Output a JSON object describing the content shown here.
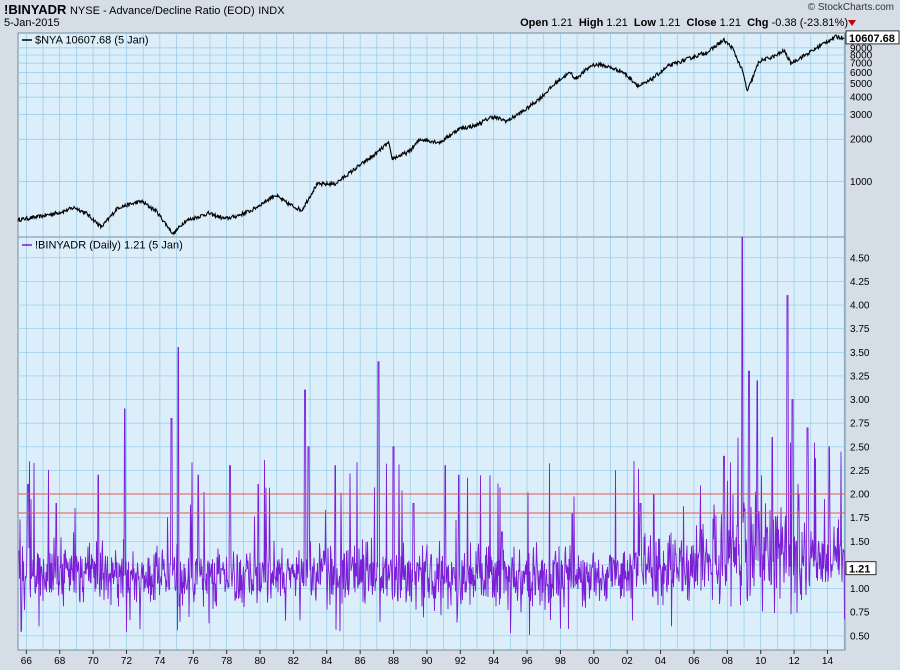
{
  "header": {
    "symbol": "!BINYADR",
    "description": "NYSE - Advance/Decline Ratio (EOD)",
    "exchange": "INDX",
    "date": "5-Jan-2015",
    "logo": "© StockCharts.com",
    "open_label": "Open",
    "open": "1.21",
    "high_label": "High",
    "high": "1.21",
    "low_label": "Low",
    "low": "1.21",
    "close_label": "Close",
    "close": "1.21",
    "chg_label": "Chg",
    "chg": "-0.38 (-23.81%)"
  },
  "colors": {
    "background": "#d5dde6",
    "plot_bg": "#dceefa",
    "grid": "#8fcbe8",
    "price_line": "#000000",
    "ratio_line": "#7a1fd6",
    "ref_line": "#e05555"
  },
  "chart_data": [
    {
      "type": "line",
      "legend": "$NYA 10607.68 (5 Jan)",
      "last_value_label": "10607.68",
      "yscale": "log",
      "y_ticks": [
        1000,
        2000,
        3000,
        4000,
        5000,
        6000,
        7000,
        8000,
        9000
      ],
      "ylim": [
        400,
        11500
      ],
      "x": [
        1965.5,
        1966.8,
        1968,
        1968.9,
        1969.6,
        1970.5,
        1971.5,
        1972.9,
        1973.8,
        1974.8,
        1975.5,
        1976.9,
        1977.9,
        1978.5,
        1979.5,
        1980.9,
        1981.6,
        1982.5,
        1983.4,
        1984.5,
        1985.9,
        1986.9,
        1987.7,
        1987.9,
        1988.9,
        1989.6,
        1990.8,
        1991.9,
        1992.9,
        1993.9,
        1994.8,
        1995.9,
        1996.9,
        1997.9,
        1998.6,
        1998.9,
        1999.9,
        2000.5,
        2001.7,
        2002.7,
        2003.2,
        2004.5,
        2005.9,
        2006.9,
        2007.4,
        2007.8,
        2008.3,
        2008.9,
        2009.2,
        2009.9,
        2010.9,
        2011.4,
        2011.8,
        2012.9,
        2013.9,
        2014.5,
        2015.0
      ],
      "values": [
        530,
        560,
        600,
        650,
        590,
        470,
        650,
        720,
        610,
        420,
        520,
        590,
        540,
        560,
        620,
        800,
        700,
        620,
        950,
        960,
        1280,
        1560,
        1890,
        1450,
        1620,
        2000,
        1900,
        2370,
        2500,
        2900,
        2700,
        3250,
        4050,
        5300,
        6000,
        5400,
        6800,
        6800,
        6100,
        4800,
        5100,
        6700,
        7700,
        8500,
        9500,
        10200,
        9000,
        6200,
        4400,
        7200,
        7900,
        8600,
        7000,
        8300,
        9900,
        10800,
        10607
      ]
    },
    {
      "type": "line",
      "legend": "!BINYADR (Daily) 1.21 (5 Jan)",
      "last_value_label": "1.21",
      "ylim": [
        0.35,
        4.72
      ],
      "y_ticks": [
        0.5,
        0.75,
        1.0,
        1.25,
        1.5,
        1.75,
        2.0,
        2.25,
        2.5,
        2.75,
        3.0,
        3.25,
        3.5,
        3.75,
        4.0,
        4.25,
        4.5
      ],
      "y_tick_labels": [
        "0.50",
        "0.75",
        "1.00",
        "1.25",
        "1.50",
        "1.75",
        "2.00",
        "2.25",
        "2.50",
        "2.75",
        "3.00",
        "3.25",
        "3.50",
        "3.75",
        "4.00",
        "4.25",
        "4.50"
      ],
      "reference_lines": [
        2.0,
        1.8
      ],
      "baseline_mean": [
        [
          1965.5,
          1.18
        ],
        [
          1975,
          1.15
        ],
        [
          1985,
          1.15
        ],
        [
          1995,
          1.13
        ],
        [
          2002,
          1.12
        ],
        [
          2006,
          1.25
        ],
        [
          2010,
          1.4
        ],
        [
          2015,
          1.3
        ]
      ],
      "spikes": [
        [
          1966.1,
          2.1
        ],
        [
          1967.8,
          1.9
        ],
        [
          1970.3,
          2.2
        ],
        [
          1971.9,
          2.9
        ],
        [
          1974.7,
          2.8
        ],
        [
          1975.1,
          3.55
        ],
        [
          1976.3,
          2.2
        ],
        [
          1978.2,
          2.3
        ],
        [
          1979.9,
          2.1
        ],
        [
          1982.7,
          3.1
        ],
        [
          1982.9,
          2.5
        ],
        [
          1984.5,
          2.3
        ],
        [
          1987.1,
          3.4
        ],
        [
          1988.0,
          2.5
        ],
        [
          1989.2,
          1.9
        ],
        [
          1991.1,
          2.3
        ],
        [
          1991.9,
          2.2
        ],
        [
          1994.5,
          1.6
        ],
        [
          1998.7,
          1.8
        ],
        [
          2002.8,
          1.9
        ],
        [
          2003.6,
          2.0
        ],
        [
          2007.8,
          2.4
        ],
        [
          2008.9,
          4.72
        ],
        [
          2009.3,
          3.3
        ],
        [
          2009.8,
          3.2
        ],
        [
          2010.7,
          2.6
        ],
        [
          2011.6,
          4.1
        ],
        [
          2011.9,
          3.0
        ],
        [
          2012.8,
          2.7
        ],
        [
          2014.1,
          2.5
        ]
      ]
    }
  ],
  "x_axis": {
    "labels": [
      "66",
      "68",
      "70",
      "72",
      "74",
      "76",
      "78",
      "80",
      "82",
      "84",
      "86",
      "88",
      "90",
      "92",
      "94",
      "96",
      "98",
      "00",
      "02",
      "04",
      "06",
      "08",
      "10",
      "12",
      "14"
    ],
    "years": [
      1966,
      1968,
      1970,
      1972,
      1974,
      1976,
      1978,
      1980,
      1982,
      1984,
      1986,
      1988,
      1990,
      1992,
      1994,
      1996,
      1998,
      2000,
      2002,
      2004,
      2006,
      2008,
      2010,
      2012,
      2014
    ],
    "range": [
      1965.5,
      2015.05
    ]
  }
}
